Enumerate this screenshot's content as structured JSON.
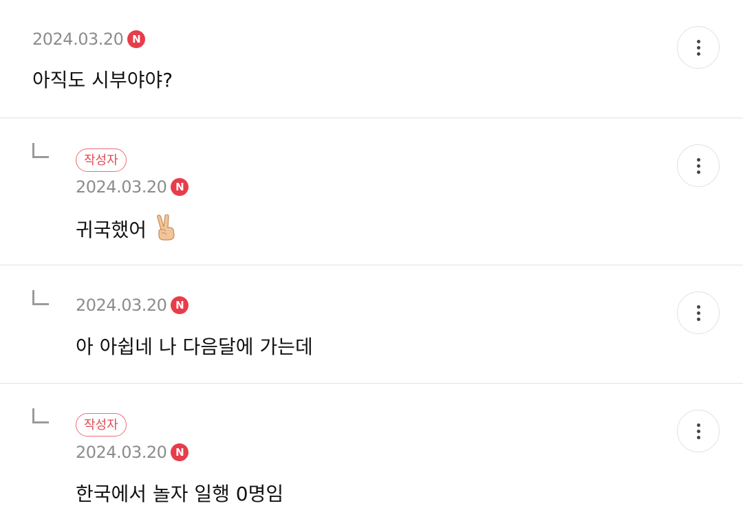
{
  "comments": [
    {
      "date": "2024.03.20",
      "new_badge": "N",
      "text": "아직도 시부야야?"
    },
    {
      "author_badge": "작성자",
      "date": "2024.03.20",
      "new_badge": "N",
      "text": "귀국했어",
      "emoji": "victory-hand"
    },
    {
      "date": "2024.03.20",
      "new_badge": "N",
      "text": "아 아쉽네 나 다음달에 가는데"
    },
    {
      "author_badge": "작성자",
      "date": "2024.03.20",
      "new_badge": "N",
      "text": "한국에서 놀자 일행 0명임"
    }
  ],
  "colors": {
    "new_badge": "#e73d4a",
    "author_badge_border": "#ef6b71",
    "date": "#8c8c8c",
    "divider": "#e3e3e3"
  },
  "icons": {
    "more": "vertical-ellipsis-icon",
    "reply": "reply-arrow-icon",
    "emoji": "victory-hand-emoji"
  }
}
